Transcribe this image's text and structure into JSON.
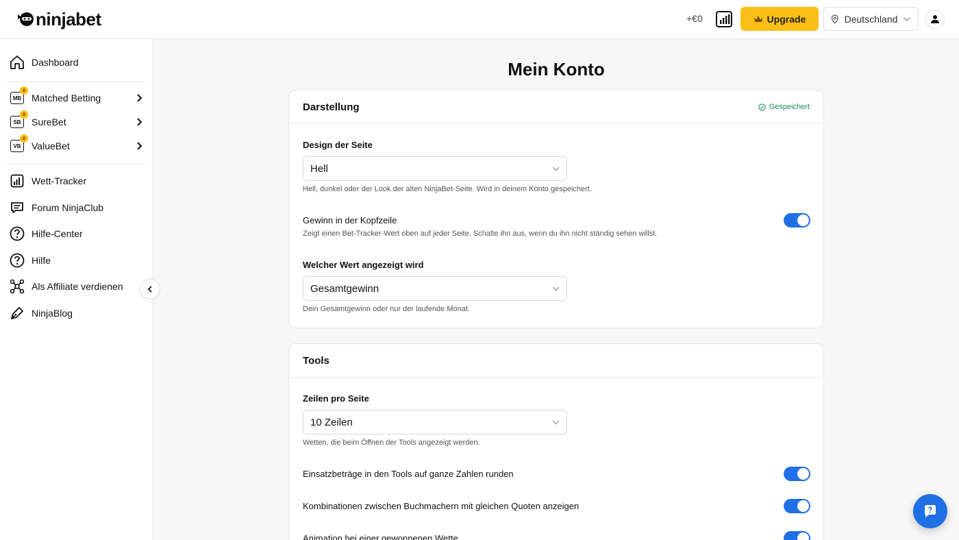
{
  "header": {
    "logo_text": "ninjabet",
    "balance": "+€0",
    "upgrade_label": "Upgrade",
    "country": "Deutschland"
  },
  "sidebar": {
    "items": [
      {
        "label": "Dashboard",
        "icon": "home-icon"
      },
      {
        "label": "Matched Betting",
        "icon": "mb-badge-icon",
        "badge": "MB"
      },
      {
        "label": "SureBet",
        "icon": "sb-badge-icon",
        "badge": "SB"
      },
      {
        "label": "ValueBet",
        "icon": "vb-badge-icon",
        "badge": "VB"
      },
      {
        "label": "Wett-Tracker",
        "icon": "chart-icon"
      },
      {
        "label": "Forum NinjaClub",
        "icon": "chat-icon"
      },
      {
        "label": "Hilfe-Center",
        "icon": "help-circle-icon"
      },
      {
        "label": "Hilfe",
        "icon": "help-circle-icon"
      },
      {
        "label": "Als Affiliate verdienen",
        "icon": "network-icon"
      },
      {
        "label": "NinjaBlog",
        "icon": "pen-icon"
      }
    ]
  },
  "main": {
    "title": "Mein Konto",
    "display": {
      "title": "Darstellung",
      "saved": "Gespeichert",
      "design_label": "Design der Seite",
      "design_value": "Hell",
      "design_help": "Hell, dunkel oder der Look der alten NinjaBet-Seite. Wird in deinem Konto gespeichert.",
      "profit_label": "Gewinn in der Kopfzeile",
      "profit_help": "Zeigt einen Bet-Tracker-Wert oben auf jeder Seite. Schalte ihn aus, wenn du ihn nicht ständig sehen willst.",
      "profit_on": true,
      "value_label": "Welcher Wert angezeigt wird",
      "value_value": "Gesamtgewinn",
      "value_help": "Dein Gesamtgewinn oder nur der laufende Monat."
    },
    "tools": {
      "title": "Tools",
      "rows_label": "Zeilen pro Seite",
      "rows_value": "10 Zeilen",
      "rows_help": "Wetten, die beim Öffnen der Tools angezeigt werden.",
      "round_label": "Einsatzbeträge in den Tools auf ganze Zahlen runden",
      "round_on": true,
      "combos_label": "Kombinationen zwischen Buchmachern mit gleichen Quoten anzeigen",
      "combos_on": true,
      "animation_label": "Animation bei einer gewonnenen Wette",
      "animation_on": true
    }
  },
  "colors": {
    "accent": "#1f6fe5",
    "upgrade": "#fbbf17",
    "saved": "#1a8a52"
  }
}
